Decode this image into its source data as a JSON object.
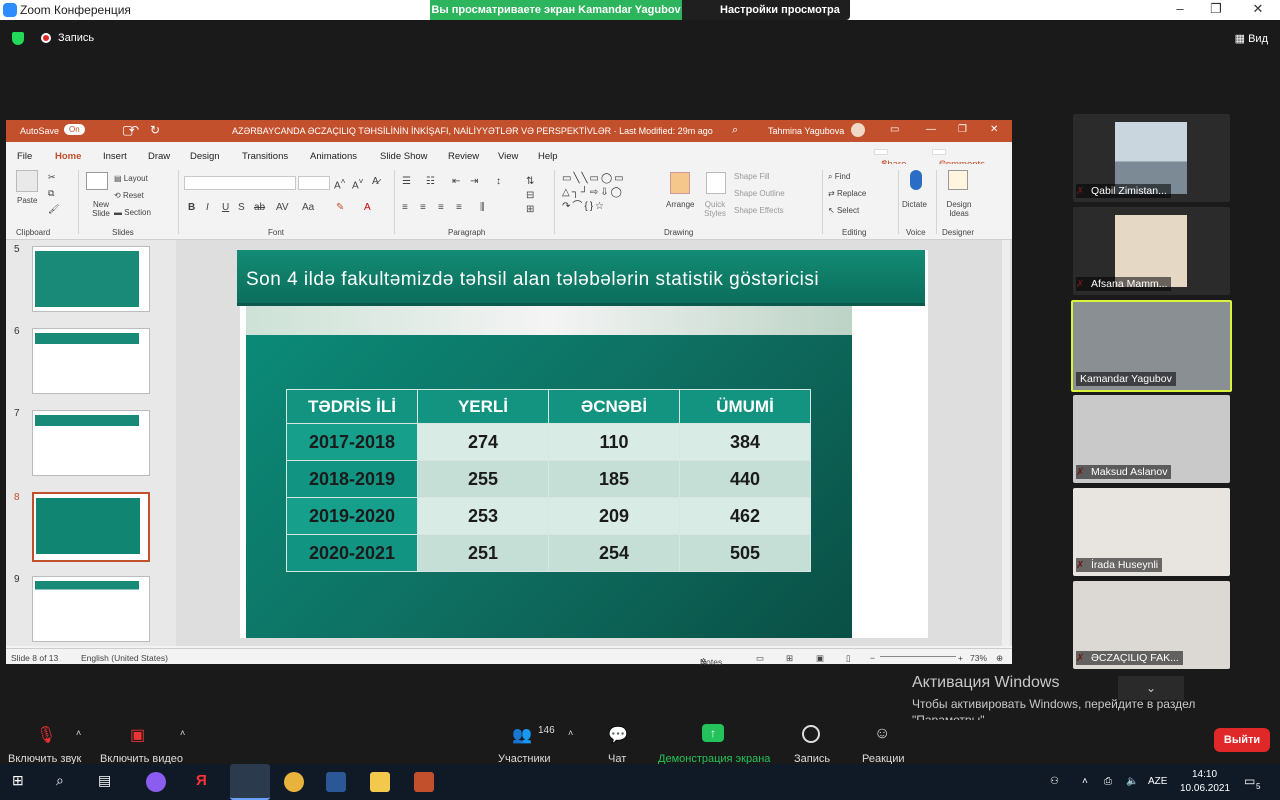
{
  "zoom": {
    "window_title": "Zoom Конференция",
    "share_banner": "Вы просматриваете экран Kamandar Yagubov",
    "view_options": "Настройки просмотра",
    "recording_label": "Запись",
    "view_label": "Вид"
  },
  "ppt": {
    "autosave": "AutoSave",
    "autosave_state": "On",
    "doc_title": "AZƏRBAYCANDA ƏCZAÇILIQ TƏHSİLİNİN İNKİŞAFI, NAİLİYYƏTLƏR VƏ PERSPEKTİVLƏR  ·  Last Modified: 29m ago",
    "user": "Tahmina Yagubova",
    "tabs": [
      "File",
      "Home",
      "Insert",
      "Draw",
      "Design",
      "Transitions",
      "Animations",
      "Slide Show",
      "Review",
      "View",
      "Help"
    ],
    "share": "Share",
    "comments": "Comments",
    "ribbon": {
      "paste": "Paste",
      "clipboard": "Clipboard",
      "new_slide": "New Slide",
      "layout": "Layout",
      "reset": "Reset",
      "section": "Section",
      "slides": "Slides",
      "font": "Font",
      "paragraph": "Paragraph",
      "arrange": "Arrange",
      "quick_styles": "Quick Styles",
      "shape_fill": "Shape Fill",
      "shape_outline": "Shape Outline",
      "shape_effects": "Shape Effects",
      "drawing": "Drawing",
      "find": "Find",
      "replace": "Replace",
      "select": "Select",
      "editing": "Editing",
      "dictate": "Dictate",
      "voice": "Voice",
      "design_ideas": "Design Ideas",
      "designer": "Designer"
    },
    "thumb_numbers": [
      "5",
      "6",
      "7",
      "8",
      "9"
    ],
    "slide_title": "Son 4 ildə fakultəmizdə təhsil alan tələbələrin statistik göstəricisi",
    "table": {
      "headers": [
        "TƏDRİS İLİ",
        "YERLİ",
        "ƏCNƏBİ",
        "ÜMUMİ"
      ],
      "rows": [
        [
          "2017-2018",
          "274",
          "110",
          "384"
        ],
        [
          "2018-2019",
          "255",
          "185",
          "440"
        ],
        [
          "2019-2020",
          "253",
          "209",
          "462"
        ],
        [
          "2020-2021",
          "251",
          "254",
          "505"
        ]
      ]
    },
    "status": {
      "slide": "Slide 8 of 13",
      "language": "English (United States)",
      "notes": "Notes",
      "zoom": "73%"
    }
  },
  "participants": [
    {
      "name": "Qabil Zimistan..."
    },
    {
      "name": "Afsana Mamm..."
    },
    {
      "name": "Kamandar Yagubov"
    },
    {
      "name": "Maksud Aslanov"
    },
    {
      "name": "İrada  Huseynli"
    },
    {
      "name": "ƏCZAÇILIQ FAK..."
    }
  ],
  "activation": {
    "title": "Активация Windows",
    "text": "Чтобы активировать Windows, перейдите в раздел \"Параметры\"."
  },
  "controls": {
    "audio": "Включить звук",
    "video": "Включить видео",
    "participants": "Участники",
    "participants_count": "146",
    "chat": "Чат",
    "share_screen": "Демонстрация экрана",
    "record": "Запись",
    "reactions": "Реакции",
    "leave": "Выйти"
  },
  "taskbar": {
    "language": "AZE",
    "time": "14:10",
    "date": "10.06.2021",
    "notifications": "5"
  }
}
